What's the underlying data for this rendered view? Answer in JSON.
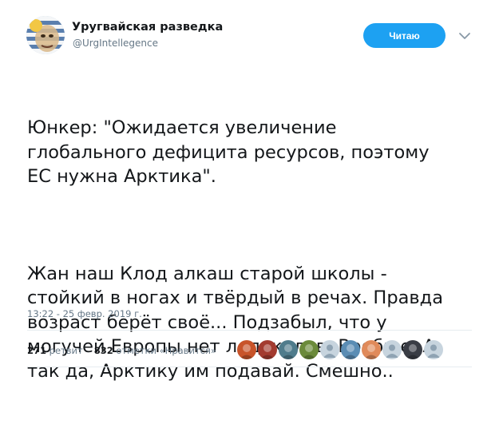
{
  "header": {
    "display_name": "Уругвайская разведка",
    "username": "@UrgIntellegence",
    "follow_button_label": "Читаю",
    "avatar_icon": "uruguay-flag-face-avatar-icon",
    "menu_icon": "chevron-down-icon"
  },
  "tweet": {
    "paragraphs": [
      "Юнкер: \"Ожидается увеличение\nглобального дефицита ресурсов, поэтому\nЕС нужна Арктика\".",
      "Жан наш Клод алкаш старой школы -\nстойкий в ногах и твёрдый в речах. Правда\nвозраст берёт своё... Подзабыл, что у\nмогучей Европы нет ледоколов. Вообще. А\nтак да, Арктику им подавай. Смешно.."
    ],
    "timestamp": "13:22 - 25 февр. 2019 г."
  },
  "stats": {
    "retweets_count": "271",
    "retweets_label": "ретвит",
    "likes_count": "832",
    "likes_label": "отметки «Нравится»"
  },
  "likers": [
    {
      "icon": "user-avatar-icon",
      "color": "#c8542a"
    },
    {
      "icon": "user-avatar-icon",
      "color": "#a33b2f"
    },
    {
      "icon": "user-avatar-icon",
      "color": "#4f7c8c"
    },
    {
      "icon": "user-avatar-icon",
      "color": "#6b8a3a"
    },
    {
      "icon": "default-egg-avatar-icon",
      "color": "#c7d4de"
    },
    {
      "icon": "user-avatar-icon",
      "color": "#5b8db4"
    },
    {
      "icon": "user-avatar-icon",
      "color": "#e08a5a"
    },
    {
      "icon": "default-egg-avatar-icon",
      "color": "#c7d4de"
    },
    {
      "icon": "user-avatar-icon",
      "color": "#3a3d45"
    },
    {
      "icon": "default-egg-avatar-icon",
      "color": "#c7d4de"
    }
  ],
  "colors": {
    "accent": "#1da1f2",
    "text": "#14171a",
    "muted": "#657786",
    "divider": "#e6ecf0"
  }
}
